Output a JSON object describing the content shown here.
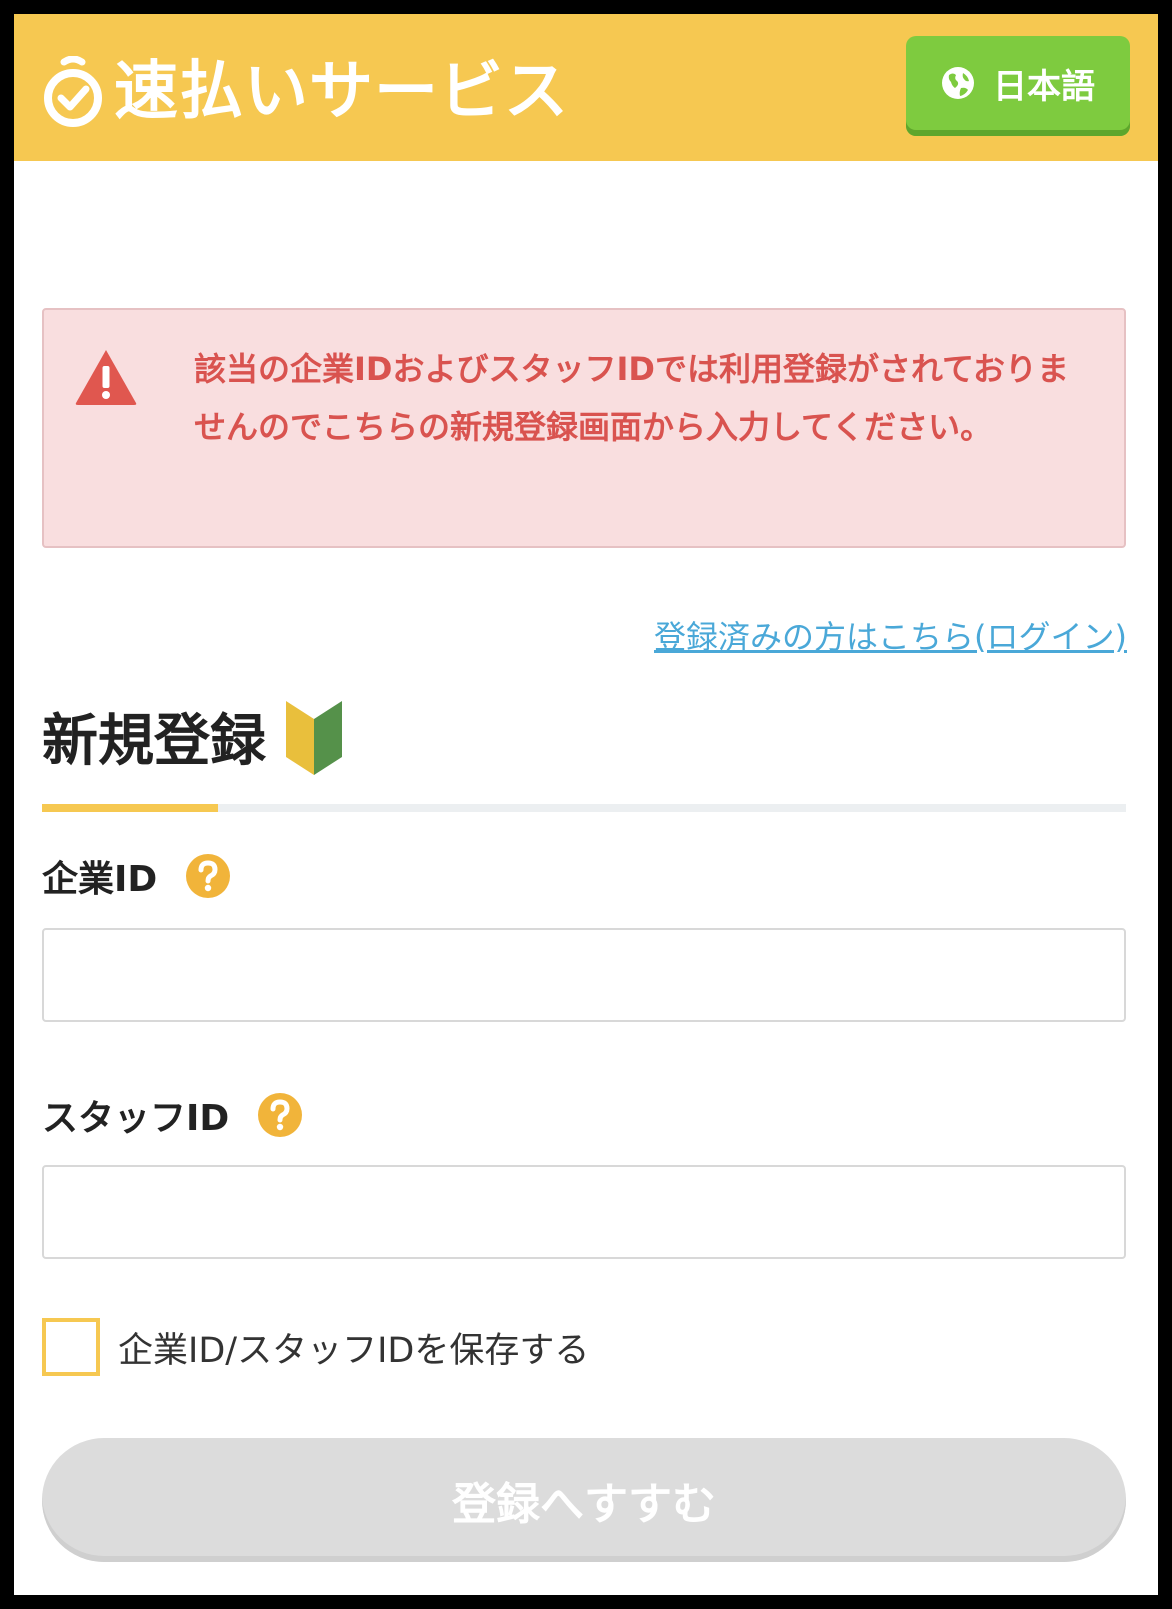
{
  "header": {
    "brand_name": "速払いサービス",
    "brand_icon": "stopwatch-check-icon",
    "language_button": {
      "label": "日本語",
      "icon": "globe-icon"
    },
    "background_color": "#f6c851"
  },
  "alert": {
    "icon": "warning-icon",
    "message": "該当の企業IDおよびスタッフIDでは利用登録がされておりませんのでこちらの新規登録画面から入力してください。",
    "text_color": "#d9534f",
    "background_color": "#f9dedf"
  },
  "login_link": {
    "label": "登録済みの方はこちら(ログイン)"
  },
  "page": {
    "title": "新規登録",
    "title_icon": "beginner-mark-icon"
  },
  "form": {
    "company_id": {
      "label": "企業ID",
      "help_icon": "help-icon",
      "value": "",
      "placeholder": ""
    },
    "staff_id": {
      "label": "スタッフID",
      "help_icon": "help-icon",
      "value": "",
      "placeholder": ""
    },
    "save_ids": {
      "label": "企業ID/スタッフIDを保存する",
      "checked": false
    },
    "submit": {
      "label": "登録へすすむ",
      "disabled": true
    }
  }
}
